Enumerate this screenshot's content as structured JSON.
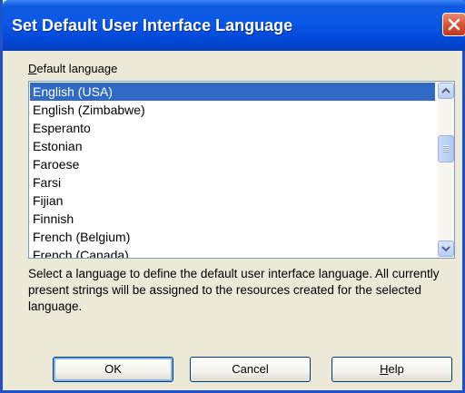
{
  "window": {
    "title": "Set Default User Interface Language"
  },
  "language_label": {
    "prefix": "D",
    "rest": "efault language"
  },
  "languages": [
    {
      "label": "English (USA)",
      "selected": true
    },
    {
      "label": "English (Zimbabwe)",
      "selected": false
    },
    {
      "label": "Esperanto",
      "selected": false
    },
    {
      "label": "Estonian",
      "selected": false
    },
    {
      "label": "Faroese",
      "selected": false
    },
    {
      "label": "Farsi",
      "selected": false
    },
    {
      "label": "Fijian",
      "selected": false
    },
    {
      "label": "Finnish",
      "selected": false
    },
    {
      "label": "French (Belgium)",
      "selected": false
    },
    {
      "label": "French (Canada)",
      "selected": false
    }
  ],
  "description": "Select a language to define the default user interface language. All currently present strings will be assigned to the resources created for the selected language.",
  "buttons": {
    "ok": "OK",
    "cancel": "Cancel",
    "help_accel": "H",
    "help_rest": "elp"
  }
}
